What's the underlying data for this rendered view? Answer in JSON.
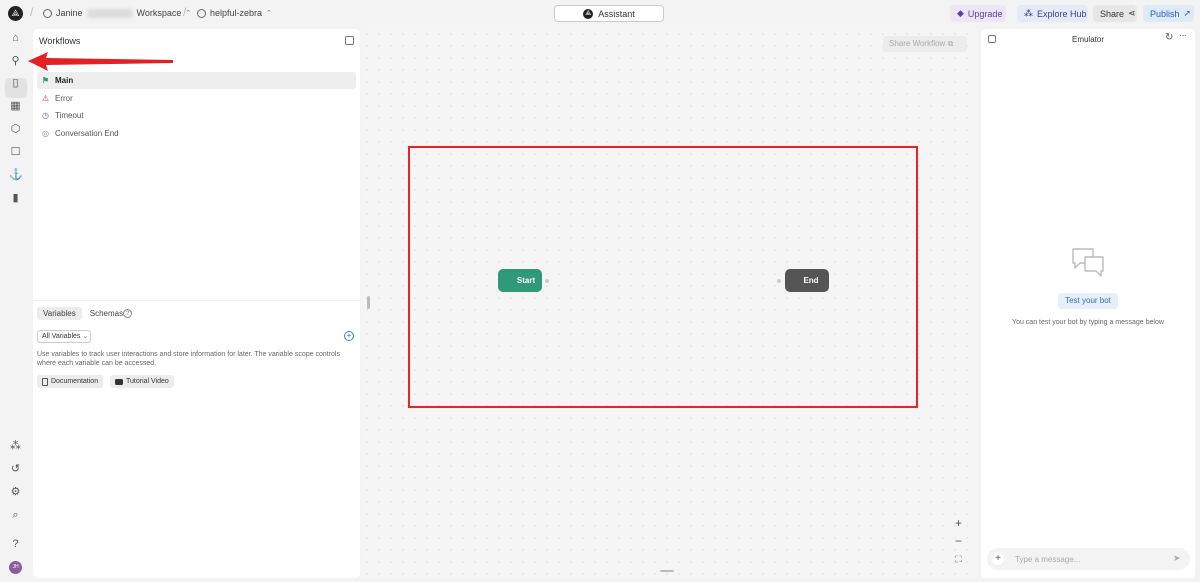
{
  "topbar": {
    "user_name": "Janine",
    "workspace_label": "Workspace",
    "project_name": "helpful-zebra",
    "center_tab_label": "Assistant",
    "upgrade_label": "Upgrade",
    "explore_hub_label": "Explore Hub",
    "share_label": "Share",
    "publish_label": "Publish"
  },
  "rail": {
    "top_icons": [
      "home-icon",
      "workflows-icon",
      "knowledge-book-icon",
      "table-icon",
      "integrations-icon",
      "bot-icon",
      "anchor-icon",
      "bookmark-icon"
    ],
    "bottom_icons": [
      "hub-icon",
      "history-icon",
      "settings-icon",
      "search-icon",
      "help-icon"
    ],
    "avatar_initials": "JH"
  },
  "workflows": {
    "title": "Workflows",
    "items": [
      {
        "label": "Main",
        "icon": "flag-icon",
        "active": true
      },
      {
        "label": "Error",
        "icon": "warning-icon",
        "active": false
      },
      {
        "label": "Timeout",
        "icon": "clock-icon",
        "active": false
      },
      {
        "label": "Conversation End",
        "icon": "end-circle-icon",
        "active": false
      }
    ]
  },
  "variables": {
    "tabs": [
      "Variables",
      "Schemas"
    ],
    "filter_value": "All Variables",
    "description": "Use variables to track user interactions and store information for later. The variable scope controls where each variable can be accessed.",
    "links": [
      "Documentation",
      "Tutorial Video"
    ]
  },
  "canvas": {
    "share_workflow_label": "Share Workflow",
    "start_node_label": "Start",
    "end_node_label": "End",
    "zoom_in": "+",
    "zoom_out": "−",
    "fit_view": "⛶"
  },
  "emulator": {
    "title": "Emulator",
    "test_button_label": "Test your bot",
    "test_description": "You can test your bot by typing a message below",
    "input_placeholder": "Type a message..."
  },
  "colors": {
    "start_node": "#2e9a78",
    "end_node": "#555555",
    "annotation_red": "#e22222",
    "publish_blue": "#2563c5"
  }
}
